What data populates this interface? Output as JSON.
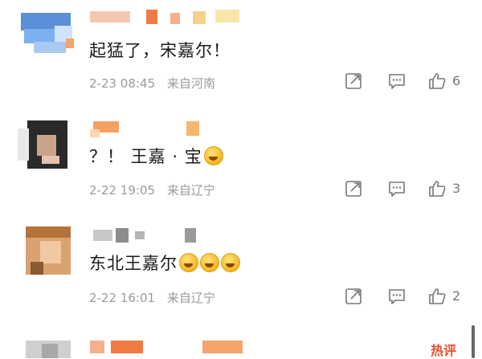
{
  "comments": [
    {
      "text": "起猛了，宋嘉尔！",
      "date": "2-23 08:45",
      "location": "来自河南",
      "likes": "6",
      "reply_icon": "share-icon",
      "comment_icon": "comment-icon",
      "like_icon": "thumbs-up-icon"
    },
    {
      "text": "？！ 王嘉 · 宝",
      "date": "2-22 19:05",
      "location": "来自辽宁",
      "likes": "3",
      "emoji_count": 1
    },
    {
      "text": "东北王嘉尔",
      "date": "2-22 16:01",
      "location": "来自辽宁",
      "likes": "2",
      "emoji_count": 3
    }
  ],
  "footer": {
    "hot_label": "热评"
  }
}
